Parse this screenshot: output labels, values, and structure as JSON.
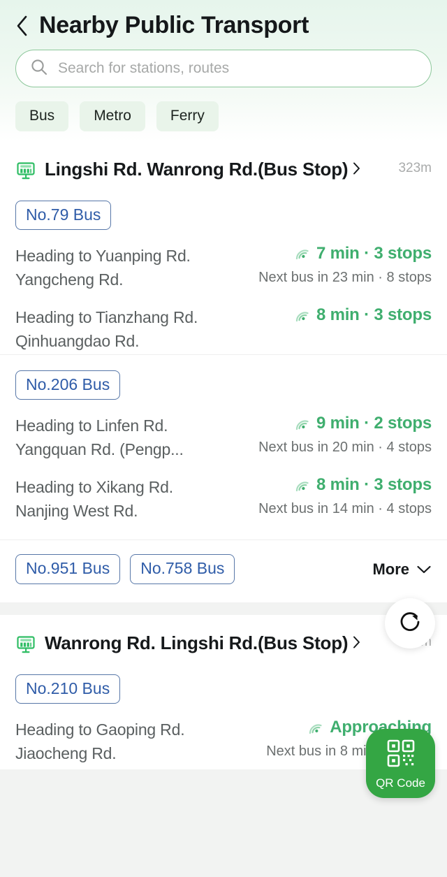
{
  "header": {
    "back_icon": "chevron-left-icon",
    "title": "Nearby Public Transport",
    "search": {
      "icon": "search-icon",
      "value": "",
      "placeholder": "Search for stations, routes"
    },
    "chips": [
      {
        "label": "Bus"
      },
      {
        "label": "Metro"
      },
      {
        "label": "Ferry"
      }
    ]
  },
  "colors": {
    "accent_green": "#3fae6e",
    "badge_blue": "#2f5ca8",
    "qr_green": "#34a644",
    "chip_bg": "#e9f4ea",
    "muted_text": "#6c7070"
  },
  "stations": [
    {
      "icon": "bus-stop-icon",
      "name": "Lingshi Rd. Wanrong Rd.(Bus Stop)",
      "chevron": "chevron-right-icon",
      "distance": "323m",
      "groups": [
        {
          "badges": [
            {
              "label": "No.79 Bus"
            }
          ],
          "directions": [
            {
              "destination": "Heading to Yuanping Rd. Yangcheng Rd.",
              "signal_icon": "signal-arc-icon",
              "eta": "7 min · 3 stops",
              "next": "Next bus in 23 min · 8 stops"
            },
            {
              "destination": "Heading to Tianzhang Rd. Qinhuangdao Rd.",
              "signal_icon": "signal-arc-icon",
              "eta": "8 min · 3 stops",
              "next": ""
            }
          ]
        },
        {
          "badges": [
            {
              "label": "No.206 Bus"
            }
          ],
          "directions": [
            {
              "destination": "Heading to Linfen Rd. Yangquan Rd. (Pengp...",
              "signal_icon": "signal-arc-icon",
              "eta": "9 min · 2 stops",
              "next": "Next bus in 20 min · 4 stops"
            },
            {
              "destination": "Heading to Xikang Rd. Nanjing West Rd.",
              "signal_icon": "signal-arc-icon",
              "eta": "8 min · 3 stops",
              "next": "Next bus in 14 min · 4 stops"
            }
          ]
        }
      ],
      "footer": {
        "badges": [
          {
            "label": "No.951 Bus"
          },
          {
            "label": "No.758 Bus"
          }
        ],
        "more_label": "More",
        "more_icon": "chevron-down-icon"
      }
    },
    {
      "icon": "bus-stop-icon",
      "name": "Wanrong Rd. Lingshi Rd.(Bus Stop)",
      "chevron": "chevron-right-icon",
      "distance": "329m",
      "groups": [
        {
          "badges": [
            {
              "label": "No.210 Bus"
            }
          ],
          "directions": [
            {
              "destination": "Heading to Gaoping Rd. Jiaocheng Rd.",
              "signal_icon": "signal-arc-icon",
              "eta": "Approaching",
              "next": "Next bus in 8 min · 2 stops"
            }
          ]
        }
      ],
      "footer": null
    }
  ],
  "floating": {
    "refresh": {
      "icon": "refresh-icon",
      "label": ""
    },
    "qr": {
      "icon": "qr-code-icon",
      "label": "QR Code"
    }
  }
}
